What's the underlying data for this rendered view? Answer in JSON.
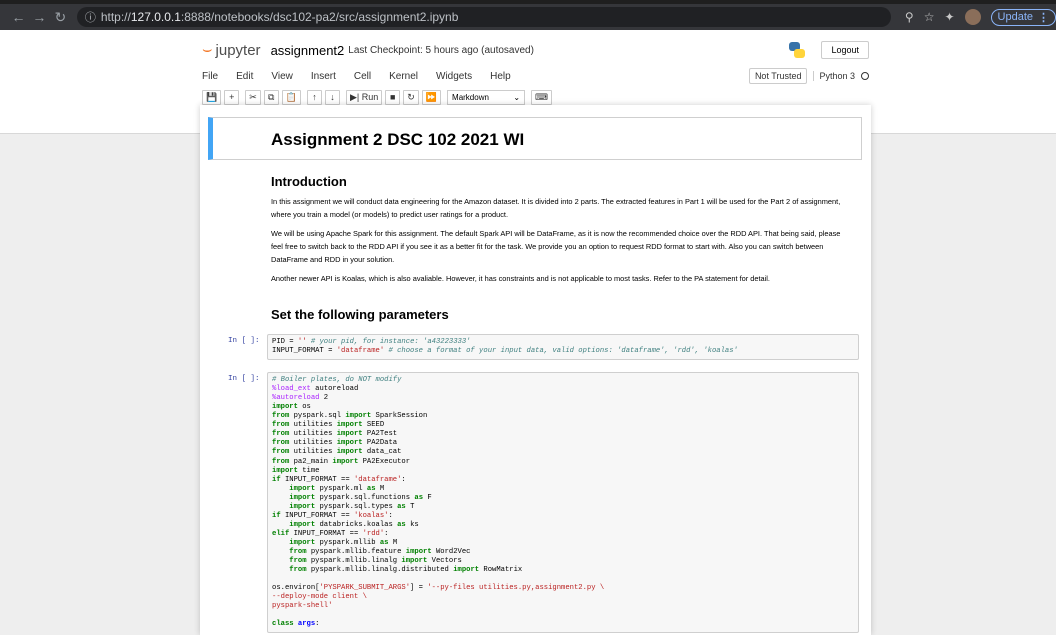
{
  "browser": {
    "url_prefix": "http://",
    "url_host": "127.0.0.1",
    "url_rest": ":8888/notebooks/dsc102-pa2/src/assignment2.ipynb",
    "update_label": "Update"
  },
  "jupyter": {
    "logo_text": "jupyter",
    "notebook_name": "assignment2",
    "checkpoint": "Last Checkpoint: 5 hours ago  (autosaved)",
    "logout_label": "Logout",
    "menu": [
      "File",
      "Edit",
      "View",
      "Insert",
      "Cell",
      "Kernel",
      "Widgets",
      "Help"
    ],
    "trust_label": "Not Trusted",
    "kernel_name": "Python 3",
    "run_label": "Run",
    "cell_type": "Markdown"
  },
  "notebook": {
    "title": "Assignment 2 DSC 102 2021 WI",
    "intro_heading": "Introduction",
    "intro_p1": "In this assignment we will conduct data engineering for the Amazon dataset. It is divided into 2 parts. The extracted features in Part 1 will be used for the Part 2 of assignment, where you train a model (or models) to predict user ratings for a product.",
    "intro_p2": "We will be using Apache Spark for this assignment. The default Spark API will be DataFrame, as it is now the recommended choice over the RDD API. That being said, please feel free to switch back to the RDD API if you see it as a better fit for the task. We provide you an option to request RDD format to start with. Also you can switch between DataFrame and RDD in your solution.",
    "intro_p3": "Another newer API is Koalas, which is also avaliable. However, it has constraints and is not applicable to most tasks. Refer to the PA statement for detail.",
    "params_heading": "Set the following parameters",
    "prompt1": "In [ ]:",
    "prompt2": "In [ ]:"
  }
}
